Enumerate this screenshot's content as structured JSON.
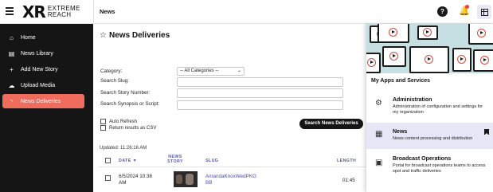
{
  "header": {
    "logo_mark": "XR",
    "logo_line1": "EXTREME",
    "logo_line2": "REACH",
    "page_label": "News",
    "help_glyph": "?",
    "bell_glyph": "🔔"
  },
  "sidebar": {
    "items": [
      {
        "label": "Home",
        "icon": "home-icon",
        "active": false
      },
      {
        "label": "News Library",
        "icon": "library-icon",
        "active": false
      },
      {
        "label": "Add New Story",
        "icon": "plus-icon",
        "active": false
      },
      {
        "label": "Upload Media",
        "icon": "cloud-upload-icon",
        "active": false
      },
      {
        "label": "News Deliveries",
        "icon": "rss-icon",
        "active": true
      }
    ]
  },
  "main": {
    "title": "News Deliveries",
    "star": "☆",
    "form": {
      "category_label": "Category:",
      "category_value": "-- All Categories --",
      "slug_label": "Search Slug:",
      "story_number_label": "Search Story Number:",
      "synopsis_label": "Search Synopsis or Script:",
      "auto_refresh_label": "Auto Refresh",
      "csv_label": "Return results as CSV",
      "search_button": "Search News Deliveries"
    },
    "updated": "Updated: 11:26:16 AM",
    "table": {
      "headers": {
        "date": "DATE ▼",
        "news_story_line1": "NEWS",
        "news_story_line2": "STORY",
        "slug": "SLUG",
        "length": "LENGTH"
      },
      "rows": [
        {
          "date_line1": "6/5/2024 10:36",
          "date_line2": "AM",
          "slug_line1": "AmandaKnoxWedPKG",
          "slug_line2": "BB",
          "length": "01:45"
        }
      ]
    }
  },
  "apps_panel": {
    "heading": "My Apps and Services",
    "items": [
      {
        "name": "Administration",
        "description": "Administration of configuration and settings for my organization",
        "icon": "gear-icon",
        "selected": false
      },
      {
        "name": "News",
        "description": "News content processing and distribution",
        "icon": "news-icon",
        "selected": true
      },
      {
        "name": "Broadcast Operations",
        "description": "Portal for broadcast operations teams to access spot and traffic deliveries",
        "icon": "broadcast-icon",
        "selected": false
      }
    ]
  },
  "colors": {
    "accent": "#f06c5c",
    "sidebar_bg": "#151515",
    "link": "#4a4ab0",
    "selected_app_bg": "#e6e6f6"
  }
}
